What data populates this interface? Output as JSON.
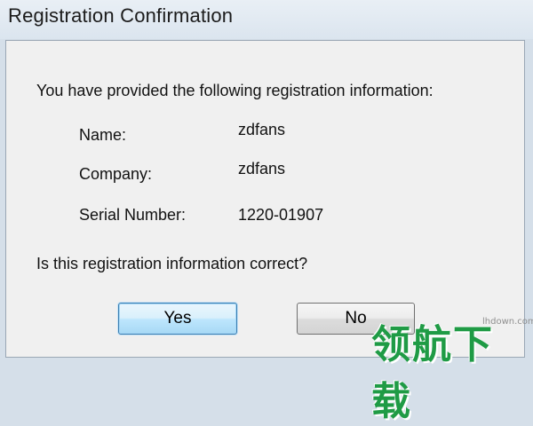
{
  "window": {
    "title": "Registration Confirmation"
  },
  "dialog": {
    "intro": "You have provided the following registration information:",
    "fields": [
      {
        "label": "Name:",
        "value": "zdfans"
      },
      {
        "label": "Company:",
        "value": "zdfans"
      },
      {
        "label": "Serial Number:",
        "value": "1220-01907"
      }
    ],
    "question": "Is this registration information correct?",
    "buttons": {
      "yes": "Yes",
      "no": "No"
    }
  },
  "watermark": {
    "url": "lhdown.com",
    "text": "领航下载"
  }
}
